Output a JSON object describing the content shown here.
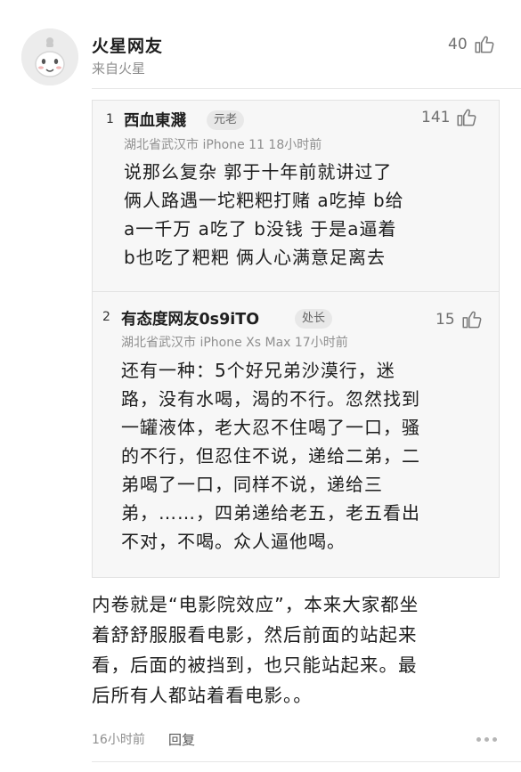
{
  "comment": {
    "user_name": "火星网友",
    "source": "来自火星",
    "likes": "40",
    "text_lines": [
      "内卷就是“电影院效应”，本来大家都坐",
      "着舒舒服服看电影，然后前面的站起来",
      "看，后面的被挡到，也只能站起来。最",
      "后所有人都站着看电影。。"
    ],
    "time": "16小时前",
    "reply_label": "回复"
  },
  "quotes": [
    {
      "floor": "1",
      "name": "西血東濺",
      "badge": "元老",
      "meta": "湖北省武汉市  iPhone 11  18小时前",
      "likes": "141",
      "text_lines": [
        "说那么复杂  郭于十年前就讲过了",
        "俩人路遇一坨粑粑打赌  a吃掉  b给",
        "a一千万  a吃了  b没钱  于是a逼着",
        "b也吃了粑粑  俩人心满意足离去"
      ]
    },
    {
      "floor": "2",
      "name": "有态度网友0s9iTO",
      "badge": "处长",
      "meta": "湖北省武汉市  iPhone Xs Max  17小时前",
      "likes": "15",
      "text_lines": [
        "还有一种：5个好兄弟沙漠行，迷",
        "路，没有水喝，渴的不行。忽然找到",
        "一罐液体，老大忍不住喝了一口，骚",
        "的不行，但忍住不说，递给二弟，二",
        "弟喝了一口，同样不说，递给三",
        "弟，……，四弟递给老五，老五看出",
        "不对，不喝。众人逼他喝。"
      ]
    }
  ],
  "icons": {
    "avatar": "mars-netizen-avatar",
    "like": "thumbs-up-icon",
    "more": "more-dots-icon"
  }
}
